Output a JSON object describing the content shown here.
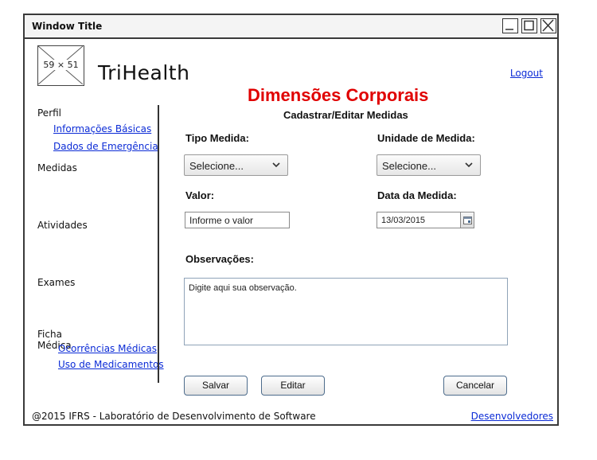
{
  "window": {
    "title": "Window Title"
  },
  "header": {
    "logo_placeholder": "59 × 51",
    "app_name": "TriHealth",
    "logout_label": "Logout"
  },
  "page": {
    "title": "Dimensões Corporais",
    "subtitle": "Cadastrar/Editar Medidas",
    "title_color": "#e00000"
  },
  "sidebar": {
    "perfil": {
      "label": "Perfil",
      "links": [
        "Informações Básicas",
        "Dados de Emergência"
      ]
    },
    "medidas": {
      "label": "Medidas"
    },
    "atividades": {
      "label": "Atividades"
    },
    "exames": {
      "label": "Exames"
    },
    "ficha": {
      "label": "Ficha Médica",
      "links": [
        "Ocorrências Médicas",
        "Uso de Medicamentos"
      ]
    }
  },
  "form": {
    "tipo_medida": {
      "label": "Tipo Medida:",
      "value": "Selecione..."
    },
    "unidade_medida": {
      "label": "Unidade de Medida:",
      "value": "Selecione..."
    },
    "valor": {
      "label": "Valor:",
      "placeholder": "Informe o valor"
    },
    "data_medida": {
      "label": "Data da Medida:",
      "value": "13/03/2015"
    },
    "observacoes": {
      "label": "Observações:",
      "placeholder": "Digite aqui sua observação."
    }
  },
  "buttons": {
    "salvar": "Salvar",
    "editar": "Editar",
    "cancelar": "Cancelar"
  },
  "footer": {
    "text": "@2015 IFRS - Laboratório de Desenvolvimento de Software",
    "link": "Desenvolvedores"
  },
  "colors": {
    "link": "#0b2bd6",
    "button_border": "#4d6c8c"
  },
  "icons": {
    "minimize": "minimize-icon",
    "maximize": "maximize-icon",
    "close": "close-icon",
    "dropdown": "chevron-down-icon",
    "calendar": "calendar-icon"
  }
}
